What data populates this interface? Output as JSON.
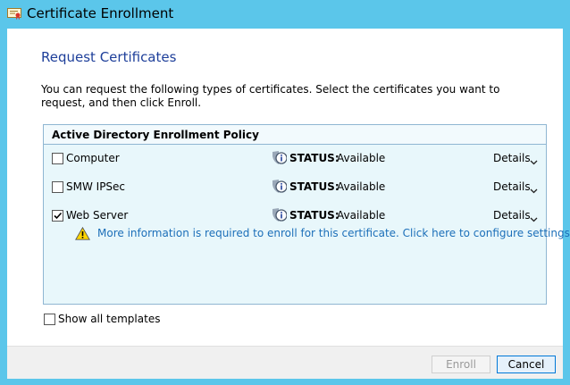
{
  "window": {
    "title": "Certificate Enrollment",
    "icon": "certificate-icon"
  },
  "page": {
    "heading": "Request Certificates",
    "intro": "You can request the following types of certificates. Select the certificates you want to request, and then click Enroll."
  },
  "policy": {
    "title": "Active Directory Enrollment Policy",
    "certificates": [
      {
        "name": "Computer",
        "checked": false,
        "status_label": "STATUS:",
        "status_value": "Available",
        "details_label": "Details"
      },
      {
        "name": "SMW IPSec",
        "checked": false,
        "status_label": "STATUS:",
        "status_value": "Available",
        "details_label": "Details"
      },
      {
        "name": "Web Server",
        "checked": true,
        "status_label": "STATUS:",
        "status_value": "Available",
        "details_label": "Details"
      }
    ],
    "warning_link": "More information is required to enroll for this certificate. Click here to configure settings."
  },
  "options": {
    "show_all_label": "Show all templates",
    "show_all_checked": false
  },
  "footer": {
    "enroll_label": "Enroll",
    "enroll_enabled": false,
    "cancel_label": "Cancel"
  },
  "colors": {
    "titlebar": "#5bc6ea",
    "heading": "#1e3f9a",
    "link": "#1c6fb9",
    "panel": "#e8f7fb"
  }
}
